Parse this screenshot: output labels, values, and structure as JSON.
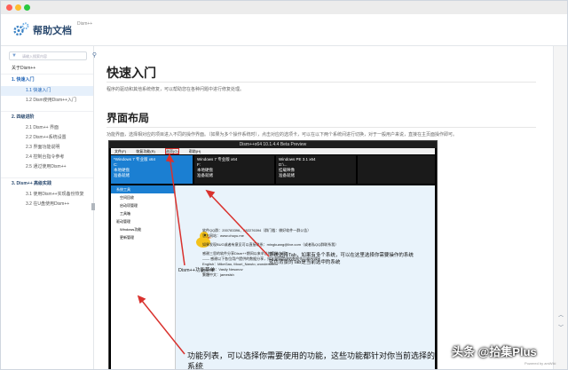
{
  "header": {
    "title": "帮助文档",
    "subtitle": "Dism++",
    "icon": "gear-icon"
  },
  "sidebar": {
    "search_placeholder": "请输入搜索内容",
    "items": [
      {
        "label": "关于Dism++",
        "level": 0
      },
      {
        "label": "1. 快速入门",
        "level": 0
      },
      {
        "label": "1.1 快速入门",
        "level": 1
      },
      {
        "label": "1.2 Dism使用Dism++入门",
        "level": 1
      },
      {
        "label": "2. 四级进阶",
        "level": 0
      },
      {
        "label": "2.1 Dism++ 界面",
        "level": 1
      },
      {
        "label": "2.2 Dism++系统设置",
        "level": 1
      },
      {
        "label": "2.3 界面功能说明",
        "level": 1
      },
      {
        "label": "2.4 控制台指令参考",
        "level": 1
      },
      {
        "label": "2.5 通过使用Dism++",
        "level": 1
      },
      {
        "label": "3. Dism++ 高级实践",
        "level": 0
      },
      {
        "label": "3.1 使用Dism++实现备份恢复",
        "level": 1
      },
      {
        "label": "3.2 在U盘使用Dism++",
        "level": 1
      }
    ]
  },
  "main": {
    "h1": "快速入门",
    "p1": "程序的驱动和其他系统修复，可以帮助您在各种问题中进行修复处理。",
    "h2": "界面布局",
    "p2": "功能界面，选择相对应的项目进入不同的操作界面。（如果为多个操作系统时），点击对应的选项卡，可以在以下两个系统间进行切换，对于一般用户来说，直接在主页面操作即可。"
  },
  "screenshot": {
    "title": "Dism++x64 10.1.4.4 Beta Preview",
    "menu": [
      "文件(F)",
      "恢复功能(R)",
      "选项(O)",
      "帮助(H)"
    ],
    "tiles": [
      {
        "name": "*Windows 7 专业版 x64",
        "drive": "C:",
        "l1": "本地硬盘",
        "l2": "准备就绪"
      },
      {
        "name": "Windows 7 专业版 x64",
        "drive": "F:",
        "l1": "本地硬盘",
        "l2": "准备就绪"
      },
      {
        "name": "Windows PE 3.1 x64",
        "drive": "D:\\...",
        "l1": "挂载映像",
        "l2": "准备就绪"
      }
    ],
    "left": {
      "group1": "系统工具",
      "items1": [
        "空间回收",
        "启动项管理",
        "工具箱"
      ],
      "group2": "驱动管理",
      "items2": [
        "Windows功能",
        "更新管理"
      ]
    },
    "info": [
      "软件QQ群：200783396、282276394（群门槛：做好软件一群公告）",
      "官方网站：www.chuyu.me",
      "如果发现BUG或者有意见可以直接联系：mingkuang@live.com（或者私QQ群联系我）",
      "感谢三思的软件分享Dism++期间以来辛苦的帮助人们：",
      "—— 感谢以下各位用户提供的数据分享，排名按照提供的数据先后顺序排序 ——",
      "English：MikeGao, Mouri_Naruto, wondersnefo",
      "русский：Vasily Nesonov",
      "繁體中文：jameslsh"
    ],
    "ann_tab": "系统选择Tab，如果有多个系统，可以在这里选择你需要操作的系统\n蓝色背景的Tab是当前选中的系统",
    "ann_menu": "Dism++功能菜单",
    "ann_func": "功能列表，可以选择你需要使用的功能，这些功能都针对你当前选择的\n系统"
  },
  "footer": {
    "powered": "Powered by amWiki",
    "watermark": "头条 @拾集Plus"
  },
  "colors": {
    "accent": "#1b7fd2",
    "link": "#1a5fb4",
    "arrow": "#d9322e"
  }
}
